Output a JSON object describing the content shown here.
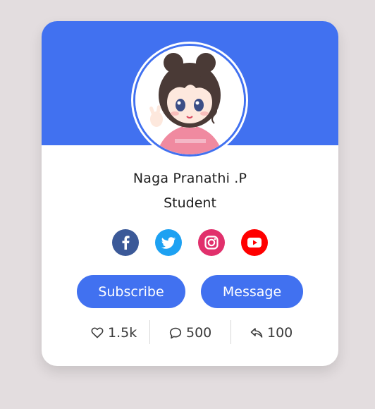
{
  "profile": {
    "name": "Naga Pranathi .P",
    "role": "Student"
  },
  "social": [
    {
      "icon": "facebook-icon",
      "color": "#3b5998"
    },
    {
      "icon": "twitter-icon",
      "color": "#1da1f2"
    },
    {
      "icon": "instagram-icon",
      "color": "#e1306c"
    },
    {
      "icon": "youtube-icon",
      "color": "#ff0000"
    }
  ],
  "buttons": {
    "subscribe_label": "Subscribe",
    "message_label": "Message"
  },
  "stats": {
    "likes": "1.5k",
    "comments": "500",
    "shares": "100"
  },
  "colors": {
    "accent": "#4171f0",
    "background": "#e3dddf"
  }
}
